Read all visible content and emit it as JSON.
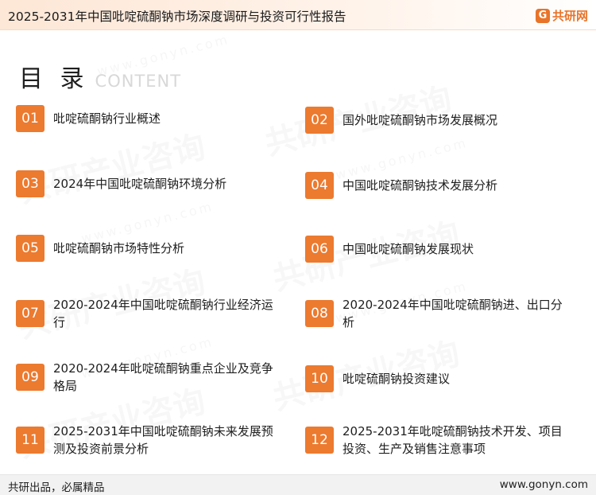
{
  "header": {
    "report_title": "2025-2031年中国吡啶硫酮钠市场深度调研与投资可行性报告",
    "brand_logo": "G",
    "brand_name": "共研网"
  },
  "toc": {
    "title": "目 录",
    "subtitle": "CONTENT",
    "items": [
      {
        "num": "01",
        "label": "吡啶硫酮钠行业概述"
      },
      {
        "num": "02",
        "label": "国外吡啶硫酮钠市场发展概况"
      },
      {
        "num": "03",
        "label": "2024年中国吡啶硫酮钠环境分析"
      },
      {
        "num": "04",
        "label": "中国吡啶硫酮钠技术发展分析"
      },
      {
        "num": "05",
        "label": "吡啶硫酮钠市场特性分析"
      },
      {
        "num": "06",
        "label": "中国吡啶硫酮钠发展现状"
      },
      {
        "num": "07",
        "label": "2020-2024年中国吡啶硫酮钠行业经济运行"
      },
      {
        "num": "08",
        "label": "2020-2024年中国吡啶硫酮钠进、出口分析"
      },
      {
        "num": "09",
        "label": "2020-2024年吡啶硫酮钠重点企业及竞争格局"
      },
      {
        "num": "10",
        "label": "吡啶硫酮钠投资建议"
      },
      {
        "num": "11",
        "label": "2025-2031年中国吡啶硫酮钠未来发展预测及投资前景分析"
      },
      {
        "num": "12",
        "label": "2025-2031年吡啶硫酮钠技术开发、项目投资、生产及销售注意事项"
      }
    ]
  },
  "watermark": {
    "brand_text": "共研产业咨询",
    "url_text": "www.gonyn.com"
  },
  "footer": {
    "slogan": "共研出品，必属精品",
    "website": "www.gonyn.com"
  },
  "colors": {
    "accent": "#ec7a2f",
    "header_bg": "#fde7d6",
    "footer_bg": "#f2f2f2"
  }
}
